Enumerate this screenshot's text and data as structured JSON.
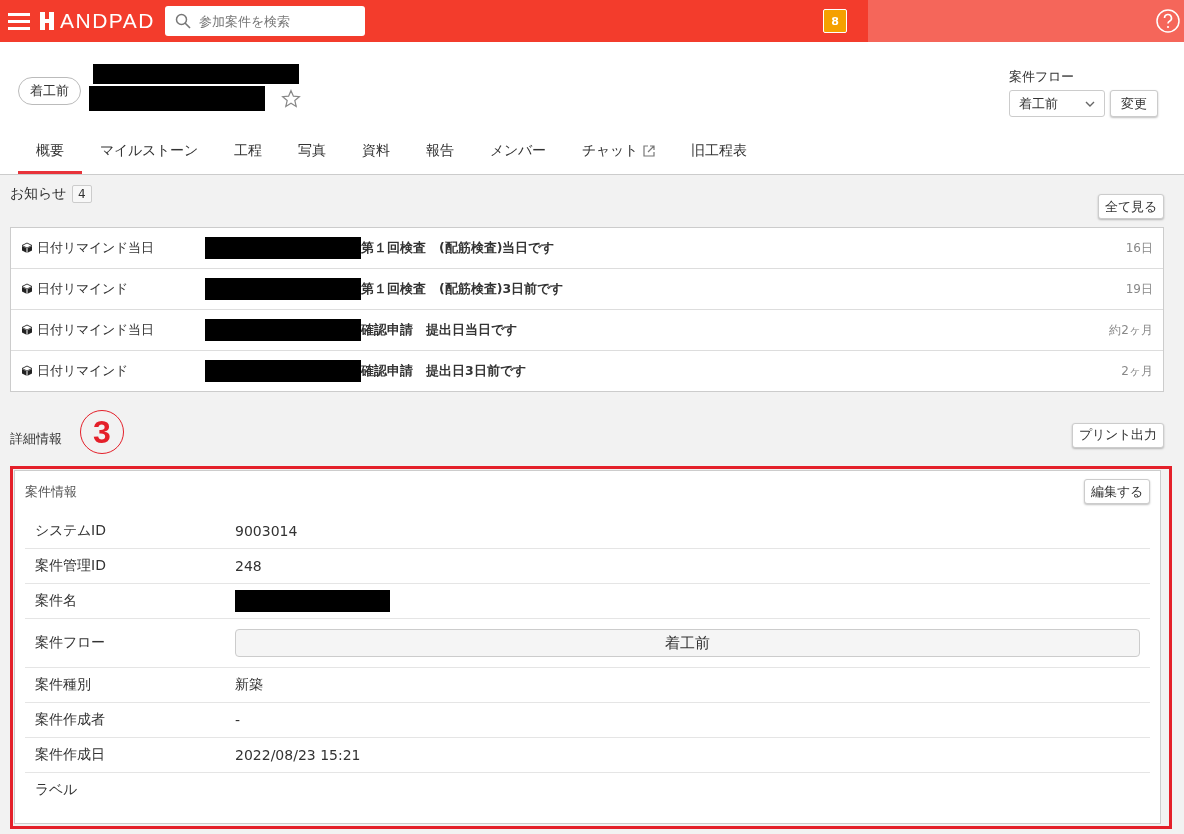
{
  "header": {
    "logo": "ANDPAD",
    "search": {
      "placeholder": "参加案件を検索"
    },
    "badge": "8"
  },
  "project": {
    "status_pill": "着工前",
    "starred": false,
    "flow_label": "案件フロー",
    "flow_select": "着工前",
    "change_button": "変更"
  },
  "tabs": [
    {
      "label": "概要",
      "selected": true,
      "external": false
    },
    {
      "label": "マイルストーン",
      "selected": false,
      "external": false
    },
    {
      "label": "工程",
      "selected": false,
      "external": false
    },
    {
      "label": "写真",
      "selected": false,
      "external": false
    },
    {
      "label": "資料",
      "selected": false,
      "external": false
    },
    {
      "label": "報告",
      "selected": false,
      "external": false
    },
    {
      "label": "メンバー",
      "selected": false,
      "external": false
    },
    {
      "label": "チャット",
      "selected": false,
      "external": true
    },
    {
      "label": "旧工程表",
      "selected": false,
      "external": false
    }
  ],
  "notices": {
    "title": "お知らせ",
    "count": "4",
    "view_all": "全て見る",
    "items": [
      {
        "type": "日付リマインド当日",
        "message": "第１回検査　(配筋検査)当日です",
        "time": "16日"
      },
      {
        "type": "日付リマインド",
        "message": "第１回検査　(配筋検査)3日前です",
        "time": "19日"
      },
      {
        "type": "日付リマインド当日",
        "message": "確認申請　提出日当日です",
        "time": "約2ヶ月"
      },
      {
        "type": "日付リマインド",
        "message": "確認申請　提出日3日前です",
        "time": "2ヶ月"
      }
    ]
  },
  "details": {
    "title": "詳細情報",
    "annotation_marker": "3",
    "print_button": "プリント出力",
    "card": {
      "title": "案件情報",
      "edit_button": "編集する",
      "rows": [
        {
          "label": "システムID",
          "kind": "text",
          "value": "9003014"
        },
        {
          "label": "案件管理ID",
          "kind": "text",
          "value": "248"
        },
        {
          "label": "案件名",
          "kind": "redacted"
        },
        {
          "label": "案件フロー",
          "kind": "button",
          "value": "着工前"
        },
        {
          "label": "案件種別",
          "kind": "text",
          "value": "新築"
        },
        {
          "label": "案件作成者",
          "kind": "text",
          "value": "-"
        },
        {
          "label": "案件作成日",
          "kind": "text",
          "value": "2022/08/23 15:21"
        },
        {
          "label": "ラベル",
          "kind": "empty"
        }
      ]
    }
  }
}
